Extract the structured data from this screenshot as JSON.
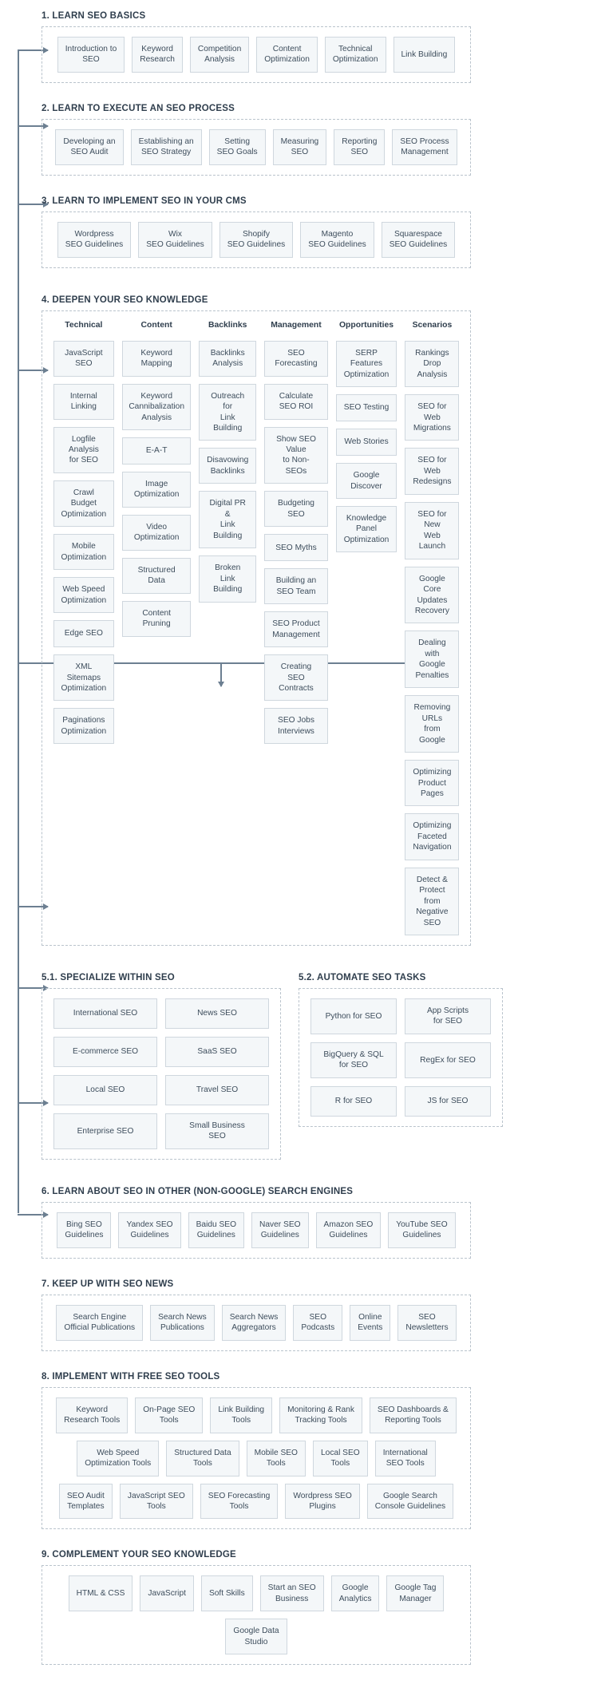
{
  "colors": {
    "line": "#6c7f91",
    "node_bg": "#f4f7f9",
    "node_border": "#cfd7de",
    "box_border": "#b9c3cc",
    "text": "#3d4d5c"
  },
  "sections": [
    {
      "id": "s1",
      "title": "1. LEARN SEO BASICS",
      "items": [
        "Introduction to\nSEO",
        "Keyword\nResearch",
        "Competition\nAnalysis",
        "Content\nOptimization",
        "Technical\nOptimization",
        "Link Building"
      ]
    },
    {
      "id": "s2",
      "title": "2. LEARN TO EXECUTE AN SEO PROCESS",
      "items": [
        "Developing an\nSEO Audit",
        "Establishing an\nSEO Strategy",
        "Setting\nSEO Goals",
        "Measuring\nSEO",
        "Reporting\nSEO",
        "SEO Process\nManagement"
      ]
    },
    {
      "id": "s3",
      "title": "3. LEARN TO IMPLEMENT SEO IN YOUR CMS",
      "items": [
        "Wordpress\nSEO Guidelines",
        "Wix\nSEO Guidelines",
        "Shopify\nSEO Guidelines",
        "Magento\nSEO Guidelines",
        "Squarespace\nSEO Guidelines"
      ]
    },
    {
      "id": "s6",
      "title": "6. LEARN ABOUT SEO IN OTHER (NON-GOOGLE) SEARCH ENGINES",
      "items": [
        "Bing SEO\nGuidelines",
        "Yandex SEO\nGuidelines",
        "Baidu SEO\nGuidelines",
        "Naver SEO\nGuidelines",
        "Amazon SEO\nGuidelines",
        "YouTube SEO\nGuidelines"
      ]
    },
    {
      "id": "s7",
      "title": "7. KEEP UP WITH SEO NEWS",
      "items": [
        "Search Engine\nOfficial Publications",
        "Search News\nPublications",
        "Search News\nAggregators",
        "SEO\nPodcasts",
        "Online\nEvents",
        "SEO\nNewsletters"
      ]
    },
    {
      "id": "s8",
      "title": "8. IMPLEMENT WITH FREE SEO TOOLS",
      "items": [
        "Keyword\nResearch Tools",
        "On-Page SEO\nTools",
        "Link Building\nTools",
        "Monitoring & Rank\nTracking Tools",
        "SEO Dashboards &\nReporting Tools",
        "Web Speed\nOptimization Tools",
        "Structured Data\nTools",
        "Mobile SEO\nTools",
        "Local SEO\nTools",
        "International\nSEO Tools",
        "SEO Audit\nTemplates",
        "JavaScript SEO\nTools",
        "SEO Forecasting\nTools",
        "Wordpress SEO\nPlugins",
        "Google Search\nConsole Guidelines"
      ]
    },
    {
      "id": "s9",
      "title": "9. COMPLEMENT YOUR SEO KNOWLEDGE",
      "items": [
        "HTML & CSS",
        "JavaScript",
        "Soft Skills",
        "Start an SEO\nBusiness",
        "Google\nAnalytics",
        "Google Tag\nManager",
        "Google Data\nStudio"
      ]
    }
  ],
  "section4": {
    "title": "4. DEEPEN YOUR SEO KNOWLEDGE",
    "columns": [
      {
        "header": "Technical",
        "items": [
          "JavaScript\nSEO",
          "Internal\nLinking",
          "Logfile Analysis\nfor SEO",
          "Crawl Budget\nOptimization",
          "Mobile\nOptimization",
          "Web Speed\nOptimization",
          "Edge SEO",
          "XML Sitemaps\nOptimization",
          "Paginations\nOptimization"
        ]
      },
      {
        "header": "Content",
        "items": [
          "Keyword\nMapping",
          "Keyword\nCannibalization\nAnalysis",
          "E-A-T",
          "Image\nOptimization",
          "Video\nOptimization",
          "Structured\nData",
          "Content\nPruning"
        ]
      },
      {
        "header": "Backlinks",
        "items": [
          "Backlinks\nAnalysis",
          "Outreach for\nLink Building",
          "Disavowing\nBacklinks",
          "Digital PR &\nLink Building",
          "Broken Link\nBuilding"
        ]
      },
      {
        "header": "Management",
        "items": [
          "SEO\nForecasting",
          "Calculate\nSEO ROI",
          "Show SEO Value\nto Non-SEOs",
          "Budgeting SEO",
          "SEO Myths",
          "Building an\nSEO Team",
          "SEO Product\nManagement",
          "Creating SEO\nContracts",
          "SEO Jobs\nInterviews"
        ]
      },
      {
        "header": "Opportunities",
        "items": [
          "SERP Features\nOptimization",
          "SEO Testing",
          "Web Stories",
          "Google\nDiscover",
          "Knowledge\nPanel\nOptimization"
        ]
      },
      {
        "header": "Scenarios",
        "items": [
          "Rankings\nDrop Analysis",
          "SEO for Web\nMigrations",
          "SEO for Web\nRedesigns",
          "SEO for New\nWeb Launch",
          "Google Core\nUpdates\nRecovery",
          "Dealing with\nGoogle\nPenalties",
          "Removing\nURLs from\nGoogle",
          "Optimizing\nProduct Pages",
          "Optimizing\nFaceted\nNavigation",
          "Detect &\nProtect  from\nNegative SEO"
        ]
      }
    ]
  },
  "section5": {
    "left": {
      "title": "5.1. SPECIALIZE WITHIN SEO",
      "items": [
        "International SEO",
        "News SEO",
        "E-commerce SEO",
        "SaaS SEO",
        "Local SEO",
        "Travel SEO",
        "Enterprise SEO",
        "Small Business\nSEO"
      ]
    },
    "right": {
      "title": "5.2. AUTOMATE SEO TASKS",
      "items": [
        "Python for SEO",
        "App Scripts\nfor SEO",
        "BigQuery & SQL\nfor SEO",
        "RegEx for SEO",
        "R for SEO",
        "JS for SEO"
      ]
    }
  }
}
